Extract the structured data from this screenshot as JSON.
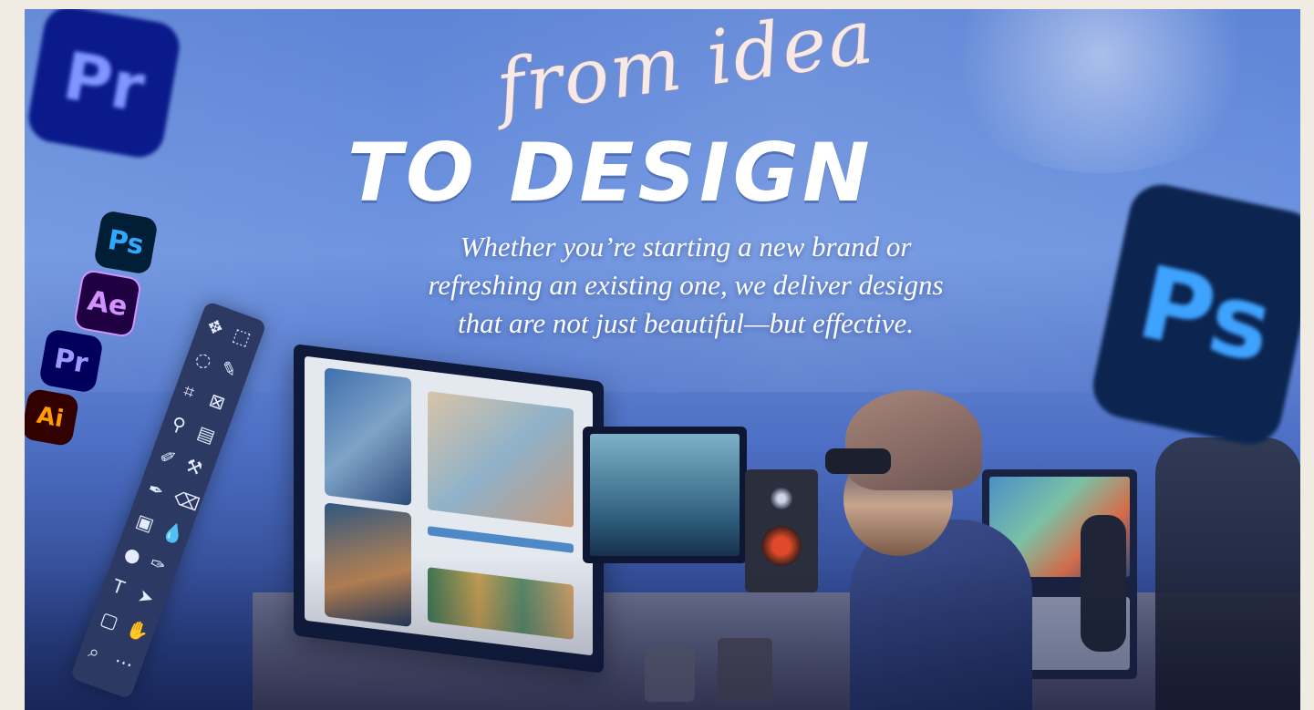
{
  "hero": {
    "headline_script": "from idea",
    "headline_bold": "TO DESIGN",
    "tagline_lines": [
      "Whether you’re starting a new brand or",
      "refreshing an existing one, we deliver designs",
      "that are not just beautiful—but effective."
    ]
  },
  "app_logos": {
    "large_left": "Pr",
    "stack": [
      "Ps",
      "Ae",
      "Pr",
      "Ai"
    ],
    "large_right": "Ps"
  },
  "colors": {
    "page_bg": "#f1ece3",
    "ps": "#31a8ff",
    "ae": "#d291ff",
    "pr": "#9999ff",
    "ai": "#ff9a00"
  },
  "toolbar_icons": [
    "move-icon",
    "marquee-icon",
    "lasso-icon",
    "quick-select-icon",
    "crop-icon",
    "frame-icon",
    "eyedropper-icon",
    "ruler-icon",
    "brush-icon",
    "stamp-icon",
    "history-brush-icon",
    "eraser-icon",
    "gradient-icon",
    "blur-icon",
    "dodge-icon",
    "pen-icon",
    "type-icon",
    "path-select-icon",
    "shape-icon",
    "hand-icon",
    "zoom-icon",
    "more-icon"
  ]
}
